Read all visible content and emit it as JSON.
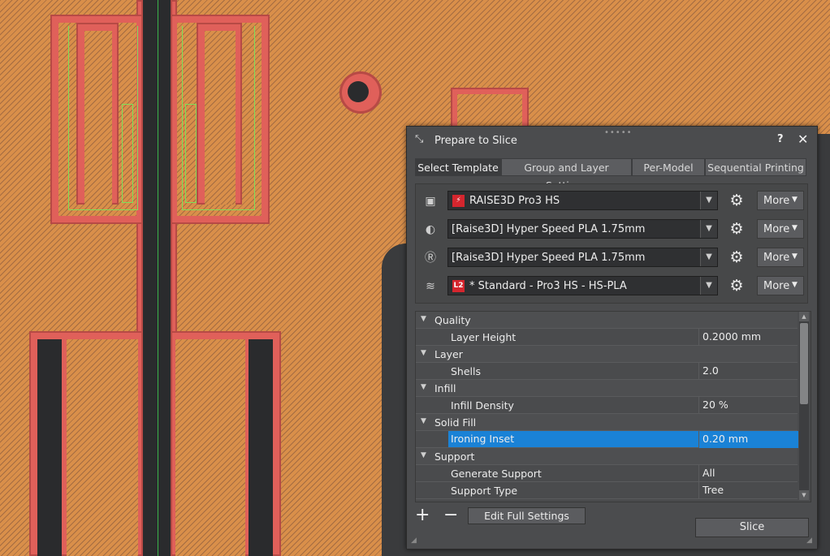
{
  "dialog": {
    "title": "Prepare to Slice",
    "help": "?",
    "close": "✕",
    "tabs": [
      "Select Template",
      "Group and Layer Settings",
      "Per-Model",
      "Sequential Printing"
    ],
    "active_tab": "Select Template"
  },
  "templates": [
    {
      "icon": "printer-icon",
      "badge": "⚡",
      "value": "RAISE3D Pro3 HS",
      "more": "More"
    },
    {
      "icon": "left-extruder-icon",
      "badge": "",
      "value": "[Raise3D] Hyper Speed PLA 1.75mm",
      "more": "More"
    },
    {
      "icon": "right-extruder-icon",
      "badge": "",
      "value": "[Raise3D] Hyper Speed PLA 1.75mm",
      "more": "More"
    },
    {
      "icon": "layers-icon",
      "badge": "L2",
      "value": "* Standard - Pro3 HS - HS-PLA",
      "more": "More"
    }
  ],
  "settings": [
    {
      "type": "group",
      "name": "Quality"
    },
    {
      "type": "param",
      "name": "Layer Height",
      "value": "0.2000 mm"
    },
    {
      "type": "group",
      "name": "Layer"
    },
    {
      "type": "param",
      "name": "Shells",
      "value": "2.0"
    },
    {
      "type": "group",
      "name": "Infill"
    },
    {
      "type": "param",
      "name": "Infill Density",
      "value": "20 %"
    },
    {
      "type": "group",
      "name": "Solid Fill"
    },
    {
      "type": "param",
      "name": "Ironing Inset",
      "value": "0.20 mm",
      "selected": true
    },
    {
      "type": "group",
      "name": "Support"
    },
    {
      "type": "param",
      "name": "Generate Support",
      "value": "All"
    },
    {
      "type": "param",
      "name": "Support Type",
      "value": "Tree"
    }
  ],
  "buttons": {
    "add": "+",
    "remove": "−",
    "edit_full": "Edit Full Settings",
    "slice": "Slice"
  },
  "colors": {
    "plate": "#d98f4a",
    "wall": "#e0605a",
    "selection": "#1a82d6",
    "badge": "#d5262e"
  }
}
